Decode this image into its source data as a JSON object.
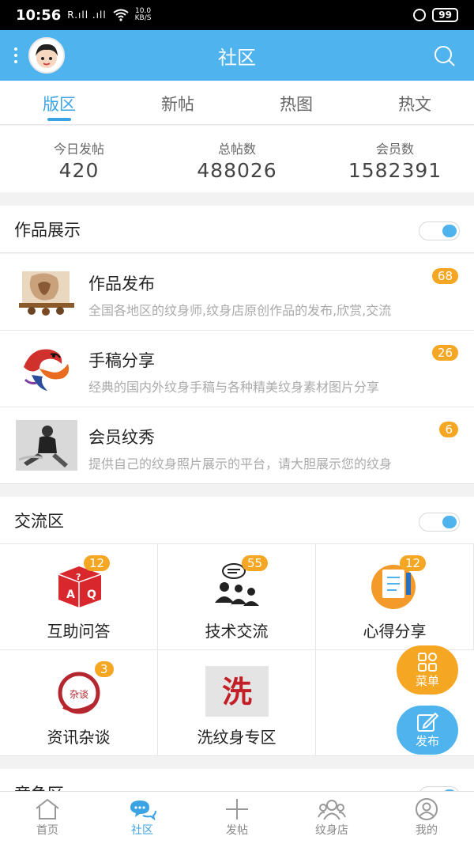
{
  "status_bar": {
    "time": "10:56",
    "signal": "R.ıll .ıll",
    "net_speed": "10.0",
    "net_unit": "KB/S",
    "battery": "99"
  },
  "app_bar": {
    "title": "社区"
  },
  "tabs": [
    {
      "label": "版区",
      "active": true
    },
    {
      "label": "新帖"
    },
    {
      "label": "热图"
    },
    {
      "label": "热文"
    }
  ],
  "stats": [
    {
      "label": "今日发帖",
      "value": "420"
    },
    {
      "label": "总帖数",
      "value": "488026"
    },
    {
      "label": "会员数",
      "value": "1582391"
    }
  ],
  "sections": [
    {
      "title": "作品展示",
      "rows": [
        {
          "name": "作品发布",
          "desc": "全国各地区的纹身师,纹身店原创作品的发布,欣赏,交流",
          "badge": "68"
        },
        {
          "name": "手稿分享",
          "desc": "经典的国内外纹身手稿与各种精美纹身素材图片分享",
          "badge": "26"
        },
        {
          "name": "会员纹秀",
          "desc": "提供自己的纹身照片展示的平台，请大胆展示您的纹身",
          "badge": "6"
        }
      ]
    },
    {
      "title": "交流区",
      "cells": [
        {
          "label": "互助问答",
          "badge": "12"
        },
        {
          "label": "技术交流",
          "badge": "55"
        },
        {
          "label": "心得分享",
          "badge": "12"
        },
        {
          "label": "资讯杂谈",
          "badge": "3"
        },
        {
          "label": "洗纹身专区",
          "badge": ""
        }
      ],
      "icon_text": {
        "qa": [
          "A",
          "?",
          "Q"
        ],
        "talk": "杂谈",
        "wash": "洗"
      }
    },
    {
      "title": "竞争区"
    }
  ],
  "fabs": {
    "menu": "菜单",
    "post": "发布"
  },
  "bottom_nav": [
    {
      "label": "首页"
    },
    {
      "label": "社区",
      "active": true
    },
    {
      "label": "发帖"
    },
    {
      "label": "纹身店"
    },
    {
      "label": "我的"
    }
  ],
  "colors": {
    "primary": "#4fb3ee",
    "accent": "#f5a623",
    "active_tab": "#3aa3e3"
  }
}
